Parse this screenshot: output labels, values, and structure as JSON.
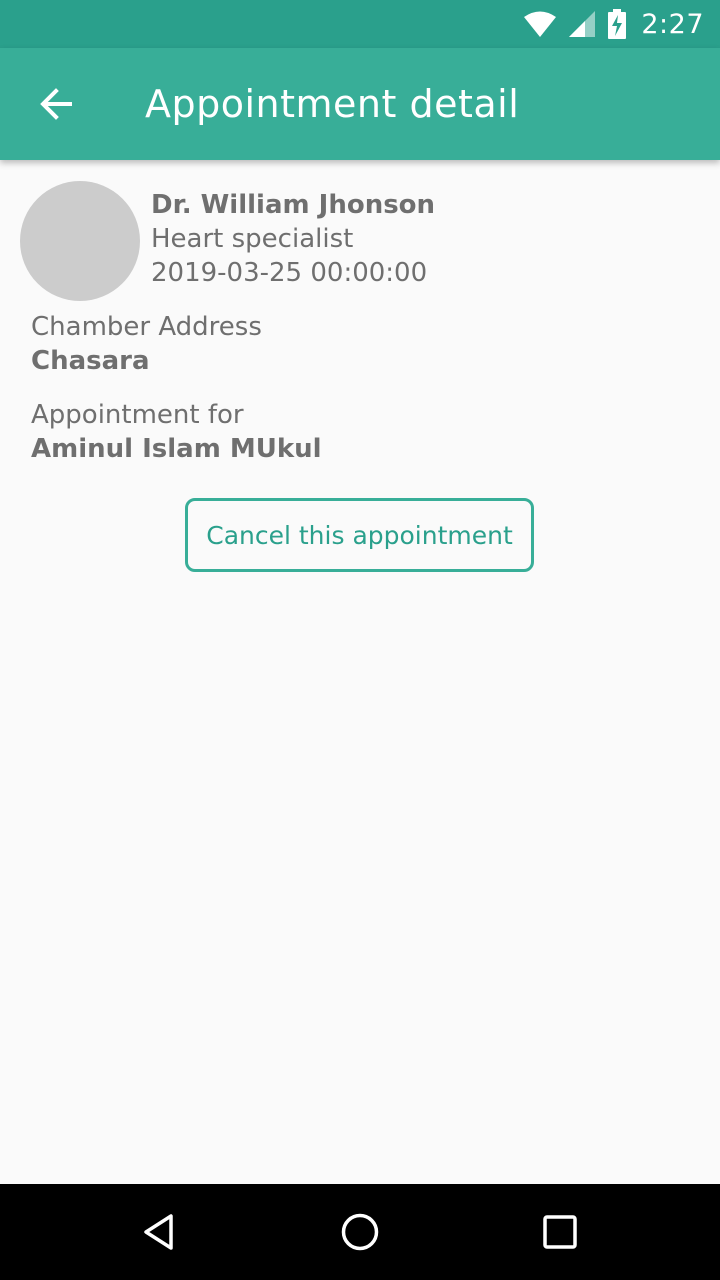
{
  "status_bar": {
    "time": "2:27",
    "icons": [
      "wifi-icon",
      "cell-signal-icon",
      "battery-charging-icon"
    ]
  },
  "app_bar": {
    "title": "Appointment detail",
    "back_icon": "arrow-left-icon"
  },
  "doctor": {
    "name": "Dr. William Jhonson",
    "specialty": "Heart specialist",
    "datetime": "2019-03-25 00:00:00"
  },
  "chamber": {
    "label": "Chamber Address",
    "value": "Chasara"
  },
  "appointment_for": {
    "label": "Appointment for",
    "value": "Aminul Islam MUkul"
  },
  "actions": {
    "cancel_label": "Cancel this appointment"
  },
  "nav_bar": {
    "icons": [
      "back-triangle-icon",
      "home-circle-icon",
      "recents-square-icon"
    ]
  },
  "colors": {
    "status_bar": "#2aa08c",
    "app_bar": "#38ae98",
    "accent": "#38ae98",
    "text_secondary": "#6f6f6f",
    "avatar_placeholder": "#cccccc",
    "background": "#fafafa"
  }
}
